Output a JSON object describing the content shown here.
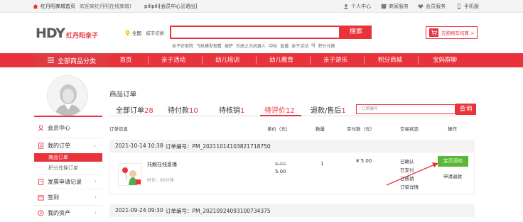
{
  "topbar": {
    "home": "红丹阳商城首页",
    "welcome": "欢迎来红丹阳在线商城!",
    "user": "pilipili[会员中心]",
    "exit": "[退出]",
    "links": [
      "个人中心",
      "商家服务",
      "会员服务",
      "手机版"
    ]
  },
  "header": {
    "logo_main": "HDY",
    "logo_sub": "红丹阳亲子",
    "city": "全国",
    "city_switch": "城市切换",
    "search_placeholder": "",
    "search_button": "搜索",
    "hot_words": [
      "亲子农家院",
      "飞机模型观看",
      "披萨",
      "乐高之光机器人",
      "中秋",
      "直播",
      "亲子活动",
      "qj",
      "积分兑换"
    ],
    "cart": "去购物车结算 >"
  },
  "nav": {
    "all_categories": "全部商品分类",
    "items": [
      "首页",
      "亲子活动",
      "幼儿培训",
      "幼儿教育",
      "亲子游乐",
      "积分商城",
      "宝妈群聊"
    ]
  },
  "sidebar": {
    "member_center": "会员中心",
    "my_orders": "我的订单",
    "product_orders": "商品订单",
    "points_orders": "积分兑换订单",
    "invoice": "发票申请记录",
    "signin": "签到",
    "assets": "我的资产"
  },
  "main": {
    "title": "商品订单",
    "tabs": [
      {
        "label": "全部订单",
        "count": "28"
      },
      {
        "label": "待付款",
        "count": "10"
      },
      {
        "label": "待核销",
        "count": "1"
      },
      {
        "label": "待评价",
        "count": "12"
      },
      {
        "label": "退款/售后",
        "count": "1"
      }
    ],
    "search_placeholder": "订单编号",
    "search_button": "查询",
    "columns": [
      "订单信息",
      "单价（元）",
      "数量",
      "实付款（元）",
      "交易状态",
      "操作"
    ],
    "orders": [
      {
        "date": "2021-10-14 10:38",
        "number": "订单编号：PM_20211014103821718750",
        "product": "托触在线直播",
        "duration": "时长：60分钟",
        "old_price": "6.00",
        "price": "5.00",
        "qty": "1",
        "paid": "¥ 5.00",
        "status": [
          "已确认",
          "已支付",
          "已核销",
          "订单详情"
        ],
        "review": "宝贝评价",
        "refund": "申请退款"
      },
      {
        "date": "2021-09-24 09:30",
        "number": "订单编号：PM_20210924093100734375"
      }
    ]
  },
  "colors": {
    "accent": "#e8323c",
    "green": "#58b835"
  }
}
